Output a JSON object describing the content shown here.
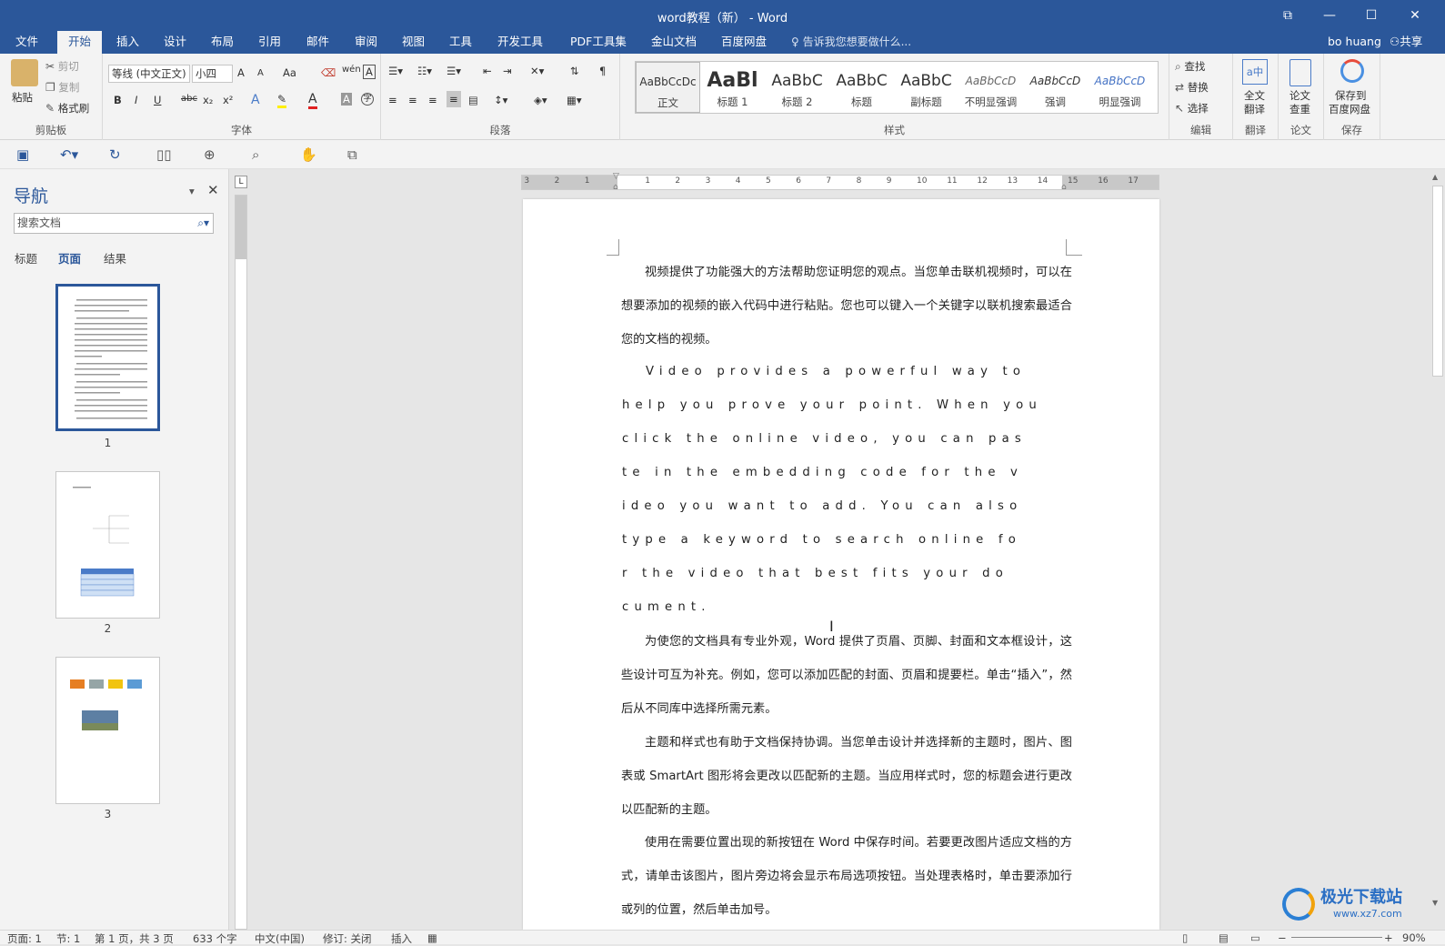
{
  "title_bar": {
    "title": "word教程（新） - Word",
    "restore": "⧉",
    "minimize": "—",
    "maximize": "☐",
    "close": "✕"
  },
  "tabs": [
    "文件",
    "开始",
    "插入",
    "设计",
    "布局",
    "引用",
    "邮件",
    "审阅",
    "视图",
    "工具",
    "开发工具",
    "PDF工具集",
    "金山文档",
    "百度网盘"
  ],
  "tell_me": "告诉我您想要做什么...",
  "user": "bo huang",
  "share": "共享",
  "clipboard": {
    "paste": "粘贴",
    "cut": "剪切",
    "copy": "复制",
    "format_painter": "格式刷",
    "label": "剪贴板"
  },
  "font": {
    "name": "等线 (中文正文)",
    "size": "小四",
    "label": "字体",
    "bold": "B",
    "italic": "I",
    "underline": "U",
    "strike": "abc",
    "sub": "x₂",
    "sup": "x²",
    "grow": "A",
    "shrink": "A",
    "case": "Aa",
    "phonetic": "wén",
    "border_char": "A"
  },
  "paragraph": {
    "label": "段落"
  },
  "styles": {
    "label": "样式",
    "items": [
      {
        "preview": "AaBbCcDc",
        "name": "正文"
      },
      {
        "preview": "AaBl",
        "name": "标题 1"
      },
      {
        "preview": "AaBbC",
        "name": "标题 2"
      },
      {
        "preview": "AaBbC",
        "name": "标题"
      },
      {
        "preview": "AaBbC",
        "name": "副标题"
      },
      {
        "preview": "AaBbCcD",
        "name": "不明显强调"
      },
      {
        "preview": "AaBbCcD",
        "name": "强调"
      },
      {
        "preview": "AaBbCcD",
        "name": "明显强调"
      }
    ]
  },
  "editing": {
    "find": "查找",
    "replace": "替换",
    "select": "选择",
    "label": "编辑"
  },
  "translate": {
    "full": "全文",
    "full2": "翻译",
    "label": "翻译"
  },
  "thesis": {
    "check": "论文",
    "check2": "查重",
    "label": "论文"
  },
  "save_group": {
    "btn": "保存到",
    "btn2": "百度网盘",
    "label": "保存"
  },
  "nav": {
    "title": "导航",
    "search_placeholder": "搜索文档",
    "tabs": [
      "标题",
      "页面",
      "结果"
    ],
    "pages": [
      "1",
      "2",
      "3"
    ]
  },
  "ruler": {
    "labels": [
      "3",
      "2",
      "1",
      "1",
      "2",
      "3",
      "4",
      "5",
      "6",
      "7",
      "8",
      "9",
      "10",
      "11",
      "12",
      "13",
      "14",
      "15",
      "16",
      "17"
    ],
    "tab_stop": "L"
  },
  "document": {
    "p1": "视频提供了功能强大的方法帮助您证明您的观点。当您单击联机视频时，可以在想要添加的视频的嵌入代码中进行粘贴。您也可以键入一个关键字以联机搜索最适合您的文档的视频。",
    "en_lines": [
      "Video provides a powerful way to",
      "help you prove your point. When you",
      "click the online video, you can pas",
      "te in the embedding code for the v",
      "ideo you want to add. You can also",
      "type a keyword to search online fo",
      "r the video that best fits your do",
      "cument."
    ],
    "p2": "为使您的文档具有专业外观，Word 提供了页眉、页脚、封面和文本框设计，这些设计可互为补充。例如，您可以添加匹配的封面、页眉和提要栏。单击“插入”，然后从不同库中选择所需元素。",
    "p3": "主题和样式也有助于文档保持协调。当您单击设计并选择新的主题时，图片、图表或 SmartArt 图形将会更改以匹配新的主题。当应用样式时，您的标题会进行更改以匹配新的主题。",
    "p4": "使用在需要位置出现的新按钮在 Word 中保存时间。若要更改图片适应文档的方式，请单击该图片，图片旁边将会显示布局选项按钮。当处理表格时，单击要添加行或列的位置，然后单击加号。"
  },
  "status": {
    "page": "页面: 1",
    "section": "节: 1",
    "page_of": "第 1 页，共 3 页",
    "words": "633 个字",
    "lang": "中文(中国)",
    "track": "修订: 关闭",
    "insert": "插入",
    "zoom": "90%"
  },
  "watermark": {
    "brand": "极光下载站",
    "url": "www.xz7.com"
  }
}
